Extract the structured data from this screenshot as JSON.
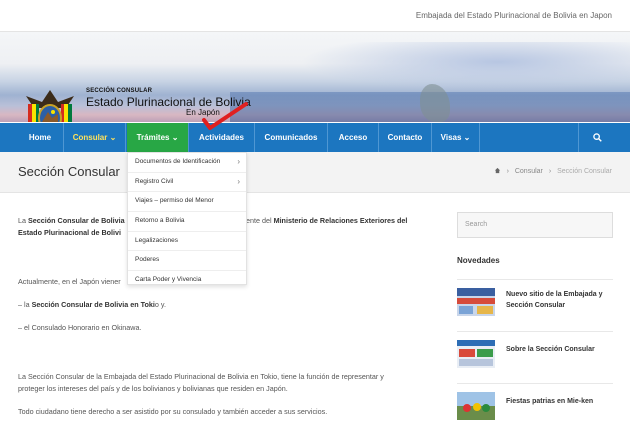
{
  "topbar": {
    "text": "Embajada del Estado Plurinacional de Bolivia en Japon"
  },
  "banner": {
    "label": "SECCIÓN CONSULAR",
    "title": "Estado Plurinacional de Bolivia",
    "subtitle": "En Japón",
    "dot_colors": [
      "#1a9e4b",
      "#e03c31",
      "#f2c200",
      "#2b6cb6",
      "#1a9e4b",
      "#e03c31",
      "#f2c200",
      "#2b6cb6",
      "#1a9e4b",
      "#e03c31",
      "#f2c200",
      "#2b6cb6",
      "#1a9e4b",
      "#e03c31"
    ]
  },
  "nav": {
    "items": [
      {
        "label": "Home"
      },
      {
        "label": "Consular ⌄"
      },
      {
        "label": "Trámites ⌄"
      },
      {
        "label": "Actividades"
      },
      {
        "label": "Comunicados"
      },
      {
        "label": "Acceso"
      },
      {
        "label": "Contacto"
      },
      {
        "label": "Visas ⌄"
      }
    ],
    "search_icon": "search-icon",
    "active_color": "#28a745",
    "bar_color": "#1c76c0"
  },
  "subheader": {
    "title": "Sección Consular",
    "breadcrumb": {
      "home_icon": "home-icon",
      "parent": "Consular",
      "current": "Sección Consular"
    }
  },
  "dropdown": {
    "items": [
      {
        "label": "Documentos de Identificación",
        "has_sub": true
      },
      {
        "label": "Registro Civil",
        "has_sub": true
      },
      {
        "label": "Viajes – permiso del Menor",
        "has_sub": false
      },
      {
        "label": "Retorno a Bolivia",
        "has_sub": false
      },
      {
        "label": "Legalizaciones",
        "has_sub": false
      },
      {
        "label": "Poderes",
        "has_sub": false
      },
      {
        "label": "Carta Poder y Vivencia",
        "has_sub": false
      }
    ]
  },
  "content": {
    "p1_a": "La ",
    "p1_b": "Sección Consular de Bolivia",
    "p1_c": "ente del ",
    "p1_d": "Ministerio de Relaciones Exteriores del",
    "p1_e": "Estado Plurinacional de Bolivi",
    "p2": "Actualmente, en el Japón viener",
    "p3_a": "– la ",
    "p3_b": "Sección Consular de Bolivia en Toki",
    "p3_c": "o y.",
    "p4": "– el Consulado Honorario en Okinawa.",
    "p5_l1": "La Sección Consular de la Embajada del Estado Plurinacional de Bolivia en Tokio, tiene la función de representar y",
    "p5_l2": "proteger los intereses del país y de los bolivianos y bolivianas que residen en Japón.",
    "p6": "Todo ciudadano tiene derecho a ser asistido por su consulado y también acceder a sus servicios."
  },
  "sidebar": {
    "search_placeholder": "Search",
    "news_title": "Novedades",
    "news": [
      {
        "title": "Nuevo sitio de la Embajada y Sección Consular"
      },
      {
        "title": "Sobre la Sección Consular"
      },
      {
        "title": "Fiestas patrias en Mie-ken"
      }
    ]
  }
}
